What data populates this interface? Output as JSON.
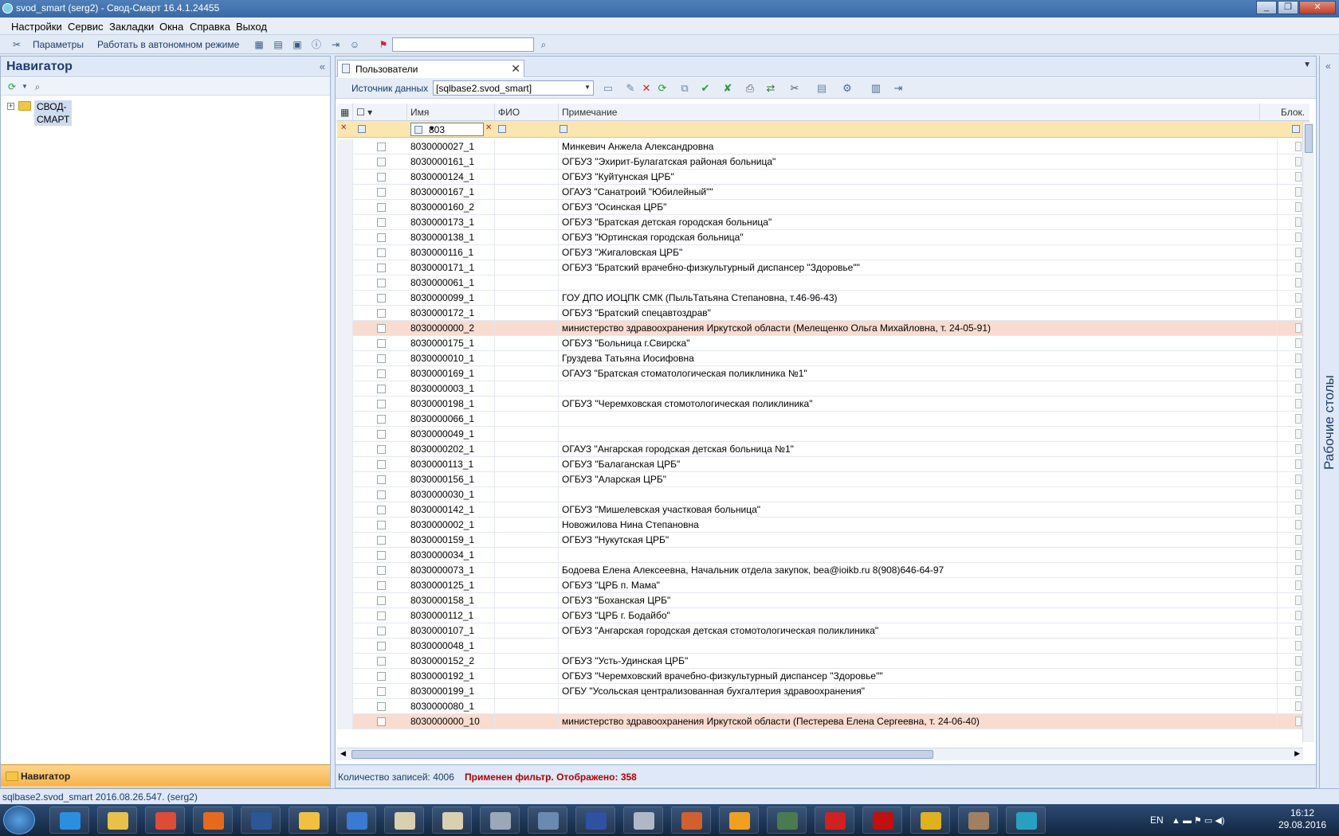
{
  "window": {
    "title": "svod_smart (serg2) - Свод-Смарт 16.4.1.24455"
  },
  "menu": [
    "Настройки",
    "Сервис",
    "Закладки",
    "Окна",
    "Справка",
    "Выход"
  ],
  "toolbar": {
    "params_label": "Параметры",
    "offline_label": "Работать в автономном режиме"
  },
  "navigator": {
    "title": "Навигатор",
    "tree_item": "СВОД-СМАРТ",
    "footer_label": "Навигатор"
  },
  "tab": {
    "label": "Пользователи"
  },
  "grid_toolbar": {
    "source_label": "Источник данных",
    "source_value": "[sqlbase2.svod_smart]"
  },
  "columns": {
    "username": "Имя пользователя",
    "fio": "ФИО",
    "note": "Примечание",
    "block": "Блок."
  },
  "filter": {
    "value": "803"
  },
  "rows": [
    {
      "user": "8030000027_1",
      "note": "Минкевич Анжела Александровна",
      "hl": false
    },
    {
      "user": "8030000161_1",
      "note": "ОГБУЗ \"Эхирит-Булагатская районая больница\"",
      "hl": false
    },
    {
      "user": "8030000124_1",
      "note": "ОГБУЗ \"Куйтунская ЦРБ\"",
      "hl": false
    },
    {
      "user": "8030000167_1",
      "note": "ОГАУЗ \"Санатроий \"Юбилейный\"\"",
      "hl": false
    },
    {
      "user": "8030000160_2",
      "note": "ОГБУЗ \"Осинская ЦРБ\"",
      "hl": false
    },
    {
      "user": "8030000173_1",
      "note": "ОГБУЗ \"Братская детская городская больница\"",
      "hl": false
    },
    {
      "user": "8030000138_1",
      "note": "ОГБУЗ \"Юртинская городская больница\"",
      "hl": false
    },
    {
      "user": "8030000116_1",
      "note": "ОГБУЗ \"Жигаловская ЦРБ\"",
      "hl": false
    },
    {
      "user": "8030000171_1",
      "note": "ОГБУЗ \"Братский врачебно-физкультурный диспансер \"Здоровье\"\"",
      "hl": false
    },
    {
      "user": "8030000061_1",
      "note": "",
      "hl": false
    },
    {
      "user": "8030000099_1",
      "note": "ГОУ ДПО ИОЦПК СМК (ПыльТатьяна Степановна, т.46-96-43)",
      "hl": false
    },
    {
      "user": "8030000172_1",
      "note": "ОГБУЗ \"Братский спецавтоздрав\"",
      "hl": false
    },
    {
      "user": "8030000000_2",
      "note": "министерство здравоохранения Иркутской области (Мелещенко Ольга Михайловна, т. 24-05-91)",
      "hl": true
    },
    {
      "user": "8030000175_1",
      "note": "ОГБУЗ \"Больница г.Свирска\"",
      "hl": false
    },
    {
      "user": "8030000010_1",
      "note": "Груздева Татьяна Иосифовна",
      "hl": false
    },
    {
      "user": "8030000169_1",
      "note": "ОГАУЗ \"Братская стоматологическая поликлиника №1\"",
      "hl": false
    },
    {
      "user": "8030000003_1",
      "note": "",
      "hl": false
    },
    {
      "user": "8030000198_1",
      "note": "ОГБУЗ \"Черемховская стомотологическая поликлиника\"",
      "hl": false
    },
    {
      "user": "8030000066_1",
      "note": "",
      "hl": false
    },
    {
      "user": "8030000049_1",
      "note": "",
      "hl": false
    },
    {
      "user": "8030000202_1",
      "note": "ОГАУЗ \"Ангарская городская детская больница №1\"",
      "hl": false
    },
    {
      "user": "8030000113_1",
      "note": "ОГБУЗ \"Балаганская ЦРБ\"",
      "hl": false
    },
    {
      "user": "8030000156_1",
      "note": "ОГБУЗ \"Аларская ЦРБ\"",
      "hl": false
    },
    {
      "user": "8030000030_1",
      "note": "",
      "hl": false
    },
    {
      "user": "8030000142_1",
      "note": "ОГБУЗ \"Мишелевская участковая больница\"",
      "hl": false
    },
    {
      "user": "8030000002_1",
      "note": "Новожилова Нина Степановна",
      "hl": false
    },
    {
      "user": "8030000159_1",
      "note": "ОГБУЗ \"Нукутская ЦРБ\"",
      "hl": false
    },
    {
      "user": "8030000034_1",
      "note": "",
      "hl": false
    },
    {
      "user": "8030000073_1",
      "note": "Бодоева Елена Алексеевна, Начальник отдела закупок, bea@ioikb.ru 8(908)646-64-97",
      "hl": false
    },
    {
      "user": "8030000125_1",
      "note": "ОГБУЗ \"ЦРБ п. Мама\"",
      "hl": false
    },
    {
      "user": "8030000158_1",
      "note": "ОГБУЗ \"Боханская ЦРБ\"",
      "hl": false
    },
    {
      "user": "8030000112_1",
      "note": "ОГБУЗ \"ЦРБ г. Бодайбо\"",
      "hl": false
    },
    {
      "user": "8030000107_1",
      "note": "ОГБУЗ \"Ангарская городская детская стомотологическая поликлиника\"",
      "hl": false
    },
    {
      "user": "8030000048_1",
      "note": "",
      "hl": false
    },
    {
      "user": "8030000152_2",
      "note": "ОГБУЗ \"Усть-Удинская ЦРБ\"",
      "hl": false
    },
    {
      "user": "8030000192_1",
      "note": "ОГБУЗ \"Черемховский врачебно-физкультурный диспансер \"Здоровье\"\"",
      "hl": false
    },
    {
      "user": "8030000199_1",
      "note": "ОГБУ \"Усольская централизованная бухгалтерия здравоохранения\"",
      "hl": false
    },
    {
      "user": "8030000080_1",
      "note": "",
      "hl": false
    },
    {
      "user": "8030000000_10",
      "note": "министерство здравоохранения Иркутской области (Пестерева Елена Сергеевна, т. 24-06-40)",
      "hl": true
    }
  ],
  "status": {
    "count": "Количество записей: 4006",
    "filter": "Применен фильтр. Отображено: 358"
  },
  "rightbar": {
    "label": "Рабочие столы"
  },
  "statusbar": {
    "text": "sqlbase2.svod_smart 2016.08.26.547. (serg2)"
  },
  "taskbar": {
    "lang": "EN",
    "time": "16:12",
    "date": "29.08.2016",
    "apps": [
      {
        "icon": "ie-icon",
        "color": "#2a8fe0"
      },
      {
        "icon": "explorer-icon",
        "color": "#e8c04a"
      },
      {
        "icon": "chrome-icon",
        "color": "#dd4b39"
      },
      {
        "icon": "firefox-icon",
        "color": "#e66a1c"
      },
      {
        "icon": "word-icon",
        "color": "#2b5797"
      },
      {
        "icon": "archive-icon",
        "color": "#f0c040"
      },
      {
        "icon": "people-icon",
        "color": "#3a7ad0"
      },
      {
        "icon": "notepad-icon",
        "color": "#d8d0b0"
      },
      {
        "icon": "notepad2-icon",
        "color": "#d8d0b0"
      },
      {
        "icon": "network-icon",
        "color": "#9aa8b8"
      },
      {
        "icon": "remote-icon",
        "color": "#6a8ab0"
      },
      {
        "icon": "books-icon",
        "color": "#3050a0"
      },
      {
        "icon": "calculator-icon",
        "color": "#b0b8c8"
      },
      {
        "icon": "paint-icon",
        "color": "#d06030"
      },
      {
        "icon": "outlook-icon",
        "color": "#f0a020"
      },
      {
        "icon": "terminal-icon",
        "color": "#4a7a50"
      },
      {
        "icon": "antivirus-icon",
        "color": "#d02020"
      },
      {
        "icon": "pdf-icon",
        "color": "#c01010"
      },
      {
        "icon": "1c-icon",
        "color": "#e0b020"
      },
      {
        "icon": "user-icon",
        "color": "#a08060"
      },
      {
        "icon": "svod-icon",
        "color": "#2aa0c0"
      }
    ]
  }
}
